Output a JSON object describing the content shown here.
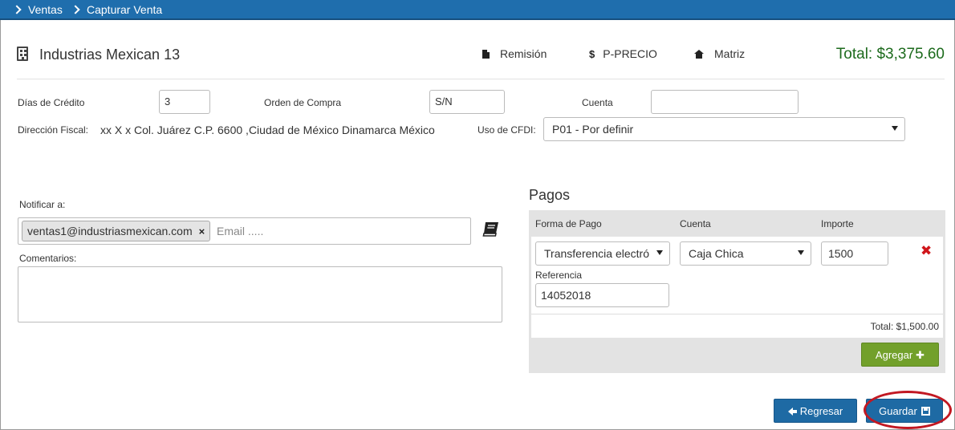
{
  "breadcrumb": {
    "items": [
      {
        "label": "Ventas"
      },
      {
        "label": "Capturar Venta"
      }
    ]
  },
  "header": {
    "client_name": "Industrias Mexican 13",
    "links": {
      "remision": "Remisión",
      "precio": "P-PRECIO",
      "matriz": "Matriz"
    },
    "precio_icon": "$",
    "total": "Total: $3,375.60"
  },
  "form": {
    "dias_credito": {
      "label": "Días de Crédito",
      "value": "3"
    },
    "orden_compra": {
      "label": "Orden de Compra",
      "value": "S/N"
    },
    "cuenta": {
      "label": "Cuenta",
      "value": ""
    },
    "direccion": {
      "label": "Dirección Fiscal:",
      "value": "xx X x Col. Juárez C.P. 6600 ,Ciudad de México Dinamarca México"
    },
    "uso_cfdi": {
      "label": "Uso de CFDI:",
      "value": "P01 - Por definir"
    }
  },
  "notificar": {
    "label": "Notificar a:",
    "tags": [
      "ventas1@industriasmexican.com"
    ],
    "tag_remove": "×",
    "email_placeholder": "Email ....."
  },
  "comentarios": {
    "label": "Comentarios:",
    "value": ""
  },
  "pagos": {
    "title": "Pagos",
    "headers": {
      "forma": "Forma de Pago",
      "cuenta": "Cuenta",
      "importe": "Importe"
    },
    "row": {
      "forma": "Transferencia electró",
      "cuenta": "Caja Chica",
      "importe": "1500",
      "referencia_label": "Referencia",
      "referencia": "14052018",
      "delete": "✖"
    },
    "total": "Total: $1,500.00",
    "agregar": "Agregar",
    "agregar_icon": "✚"
  },
  "actions": {
    "regresar": "Regresar",
    "guardar": "Guardar"
  },
  "colors": {
    "topbar": "#1f6ead",
    "total": "#1d6b1d",
    "green_button": "#72a02b",
    "blue_button": "#1e6aa4",
    "delete": "#d0161b",
    "highlight": "#c21822"
  }
}
